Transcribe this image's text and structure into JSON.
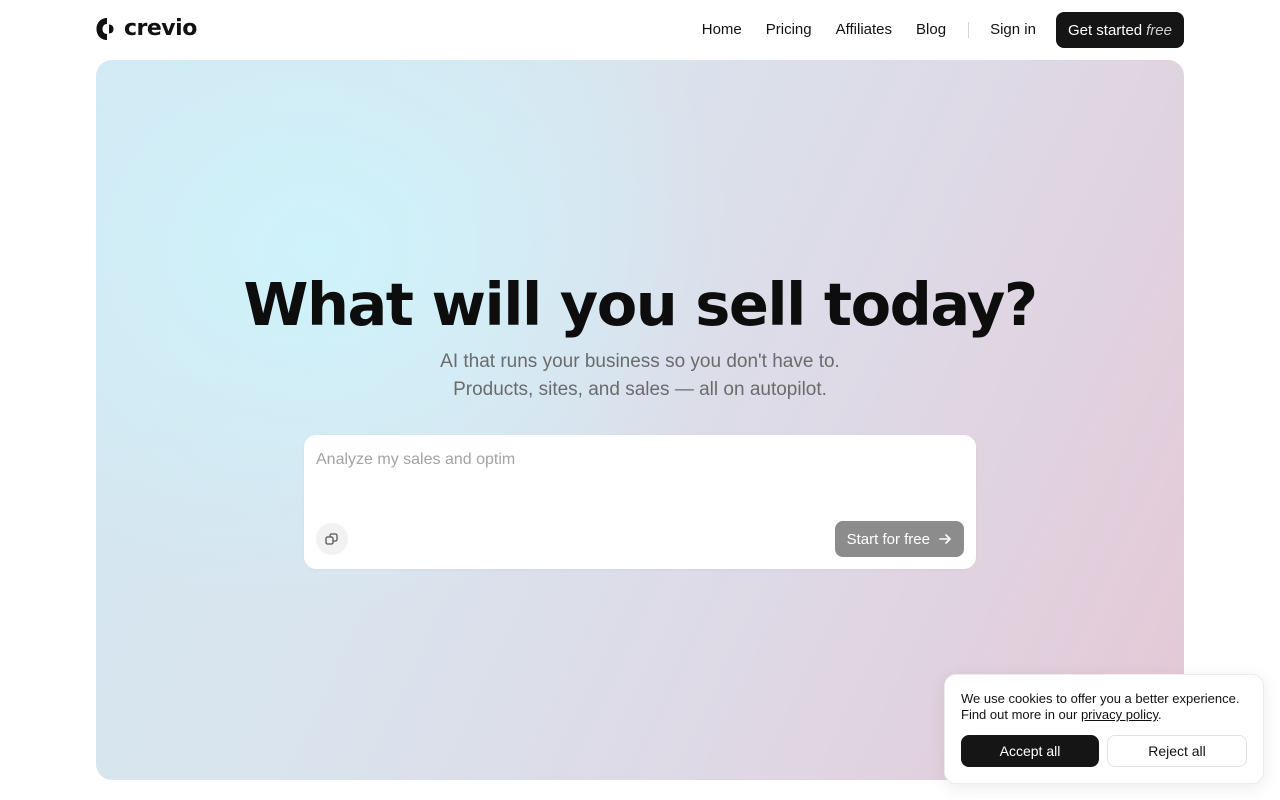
{
  "header": {
    "logo_text": "crevio",
    "nav": [
      {
        "label": "Home"
      },
      {
        "label": "Pricing"
      },
      {
        "label": "Affiliates"
      },
      {
        "label": "Blog"
      }
    ],
    "signin_label": "Sign in",
    "cta": {
      "label": "Get started",
      "emphasis": "free"
    }
  },
  "hero": {
    "title": "What will you sell today?",
    "subtitle_line1": "AI that runs your business so you don't have to.",
    "subtitle_line2": "Products, sites, and sales — all on autopilot.",
    "prompt": {
      "placeholder": "Analyze my sales and optim",
      "value": "",
      "attach_icon": "attach-icon",
      "submit_label": "Start for free",
      "submit_icon": "arrow-right-icon"
    }
  },
  "cookie_banner": {
    "text_line1": "We use cookies to offer you a better experience.",
    "text_line2_prefix": "Find out more in our ",
    "link_text": "privacy policy",
    "text_line2_suffix": ".",
    "accept_label": "Accept all",
    "reject_label": "Reject all"
  },
  "colors": {
    "primary_button": "#151515",
    "disabled_button": "#8c8c8c",
    "hero_gradient_start": "#cef4fc",
    "hero_gradient_end": "#e5c8d5"
  }
}
